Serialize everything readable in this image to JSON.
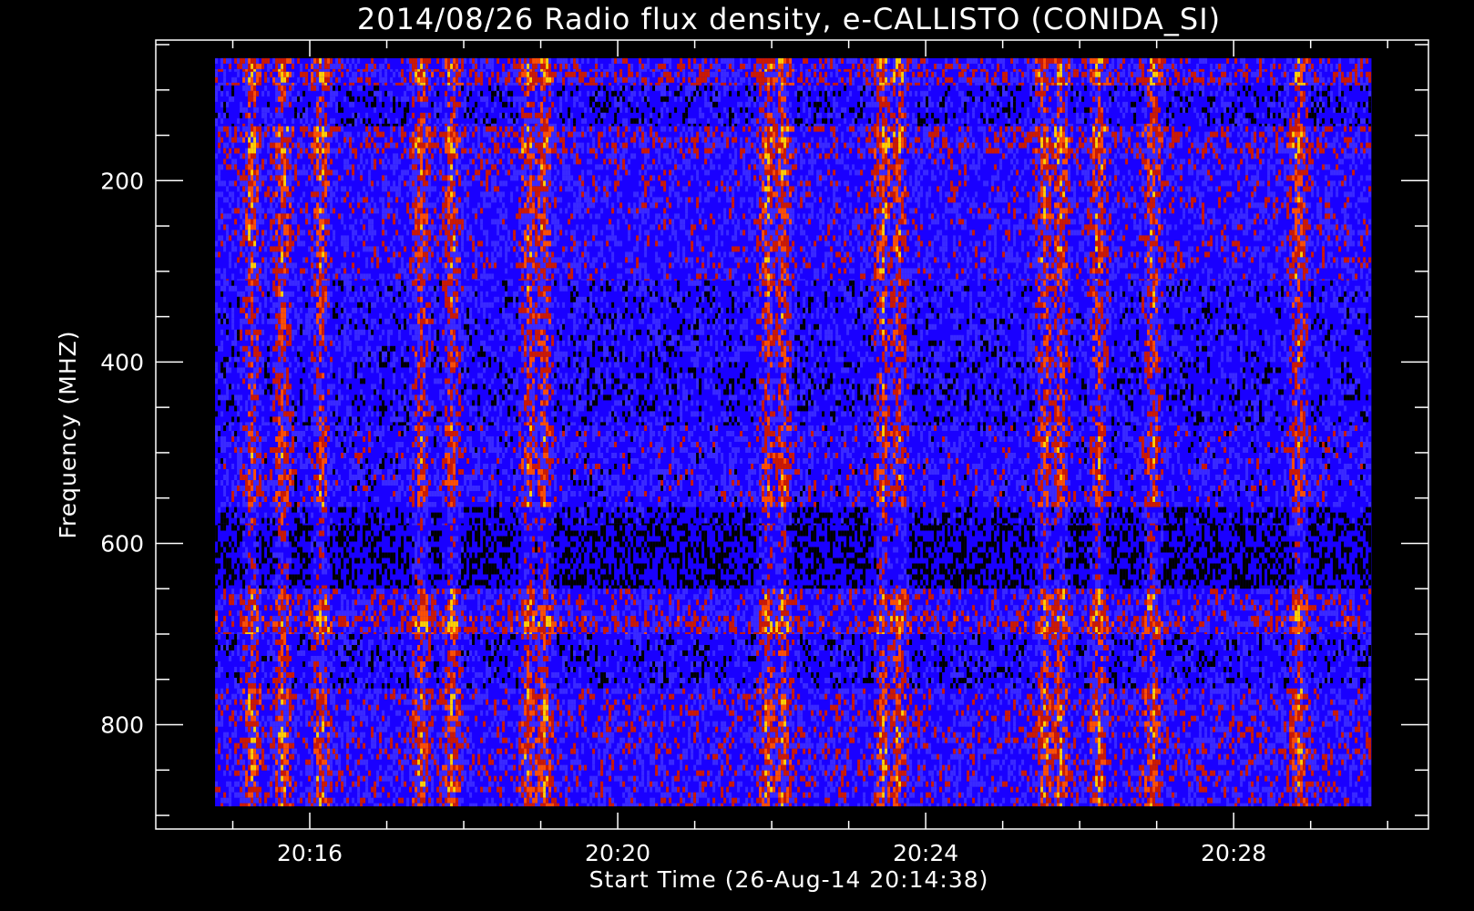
{
  "chart_data": {
    "type": "heatmap",
    "title": "2014/08/26  Radio flux density, e-CALLISTO (CONIDA_SI)",
    "xlabel": "Start Time (26-Aug-14 20:14:38)",
    "ylabel": "Frequency (MHZ)",
    "x_ticks": [
      "20:16",
      "20:20",
      "20:24",
      "20:28"
    ],
    "y_ticks": [
      "200",
      "400",
      "600",
      "800"
    ],
    "x_tick_minutes": [
      1.37,
      5.37,
      9.37,
      13.37
    ],
    "x_range_minutes": [
      -0.63,
      15.9
    ],
    "x_data_range_minutes": [
      0.14,
      15.16
    ],
    "y_range": [
      45,
      915
    ],
    "y_data_range": [
      65,
      890
    ],
    "y_inverted": true,
    "colormap": [
      "#000000",
      "#1a00ff",
      "#3a2aff",
      "#cc1a00",
      "#ff5000",
      "#ffd000"
    ],
    "bands_mhz": [
      {
        "from": 65,
        "to": 80,
        "level": 0.55
      },
      {
        "from": 80,
        "to": 95,
        "level": 0.62
      },
      {
        "from": 95,
        "to": 140,
        "level": 0.28
      },
      {
        "from": 140,
        "to": 170,
        "level": 0.6
      },
      {
        "from": 170,
        "to": 310,
        "level": 0.45
      },
      {
        "from": 310,
        "to": 400,
        "level": 0.35
      },
      {
        "from": 400,
        "to": 470,
        "level": 0.3
      },
      {
        "from": 470,
        "to": 560,
        "level": 0.42
      },
      {
        "from": 560,
        "to": 580,
        "level": 0.15
      },
      {
        "from": 580,
        "to": 650,
        "level": 0.05
      },
      {
        "from": 650,
        "to": 680,
        "level": 0.5
      },
      {
        "from": 680,
        "to": 700,
        "level": 0.65
      },
      {
        "from": 700,
        "to": 760,
        "level": 0.3
      },
      {
        "from": 760,
        "to": 890,
        "level": 0.5
      }
    ],
    "bright_columns_minutes": [
      0.6,
      1.0,
      1.5,
      2.8,
      3.2,
      4.2,
      4.4,
      7.3,
      7.5,
      8.8,
      9.0,
      10.9,
      11.1,
      11.6,
      12.3,
      14.2
    ]
  }
}
